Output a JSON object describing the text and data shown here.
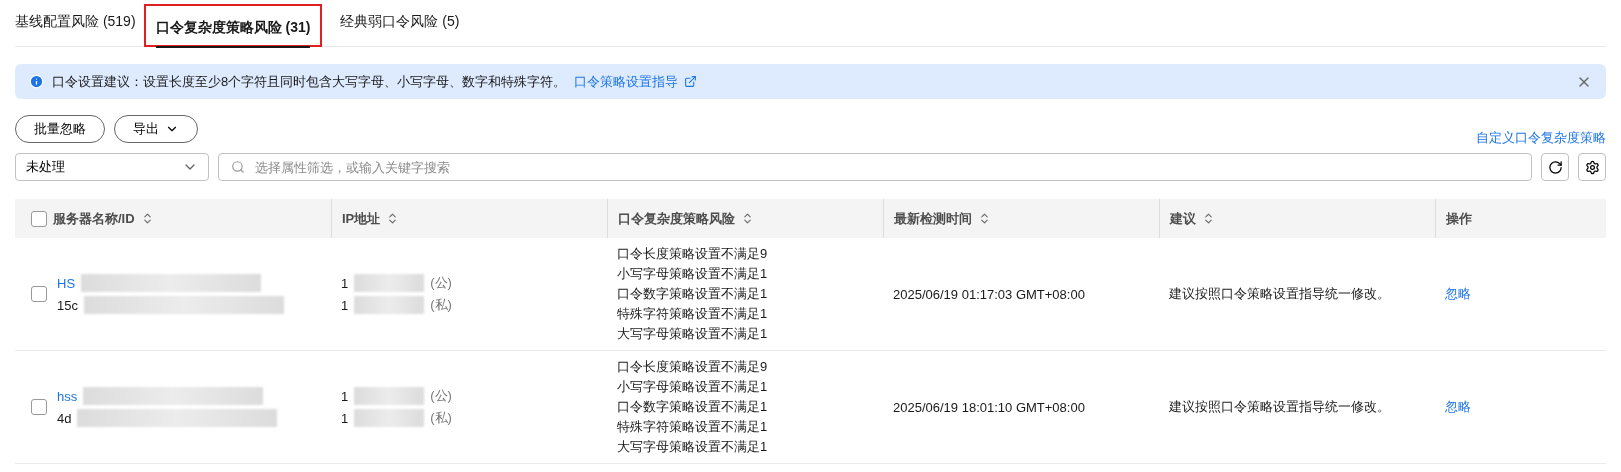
{
  "tabs": [
    {
      "label": "基线配置风险 (519)",
      "selected": false
    },
    {
      "label": "口令复杂度策略风险 (31)",
      "selected": true,
      "annotated": true
    },
    {
      "label": "经典弱口令风险 (5)",
      "selected": false
    }
  ],
  "alert": {
    "text": "口令设置建议：设置长度至少8个字符且同时包含大写字母、小写字母、数字和特殊字符。",
    "link": "口令策略设置指导"
  },
  "toolbar": {
    "buttons": [
      {
        "label": "批量忽略",
        "dropdown": false
      },
      {
        "label": "导出",
        "dropdown": true
      }
    ],
    "link": "自定义口令复杂度策略"
  },
  "filter": {
    "status": "未处理",
    "placeholder": "选择属性筛选，或输入关键字搜索"
  },
  "table": {
    "all_checked": false,
    "columns": [
      {
        "label": "服务器名称/ID",
        "sortable": true
      },
      {
        "label": "IP地址",
        "sortable": true
      },
      {
        "label": "口令复杂度策略风险",
        "sortable": true
      },
      {
        "label": "最新检测时间",
        "sortable": true
      },
      {
        "label": "建议",
        "sortable": true
      },
      {
        "label": "操作",
        "sortable": false
      }
    ],
    "rows": [
      {
        "checked": false,
        "name": "HS",
        "id": "15c",
        "ips": [
          {
            "value": "1",
            "type": "(公)"
          },
          {
            "value": "1",
            "type": "(私)"
          }
        ],
        "risks": [
          "口令长度策略设置不满足9",
          "小写字母策略设置不满足1",
          "口令数字策略设置不满足1",
          "特殊字符策略设置不满足1",
          "大写字母策略设置不满足1"
        ],
        "time": "2025/06/19 01:17:03 GMT+08:00",
        "advice": "建议按照口令策略设置指导统一修改。",
        "action": "忽略"
      },
      {
        "checked": false,
        "name": "hss",
        "id": "4d",
        "ips": [
          {
            "value": "1",
            "type": "(公)"
          },
          {
            "value": "1",
            "type": "(私)"
          }
        ],
        "risks": [
          "口令长度策略设置不满足9",
          "小写字母策略设置不满足1",
          "口令数字策略设置不满足1",
          "特殊字符策略设置不满足1",
          "大写字母策略设置不满足1"
        ],
        "time": "2025/06/19 18:01:10 GMT+08:00",
        "advice": "建议按照口令策略设置指导统一修改。",
        "action": "忽略"
      }
    ]
  }
}
